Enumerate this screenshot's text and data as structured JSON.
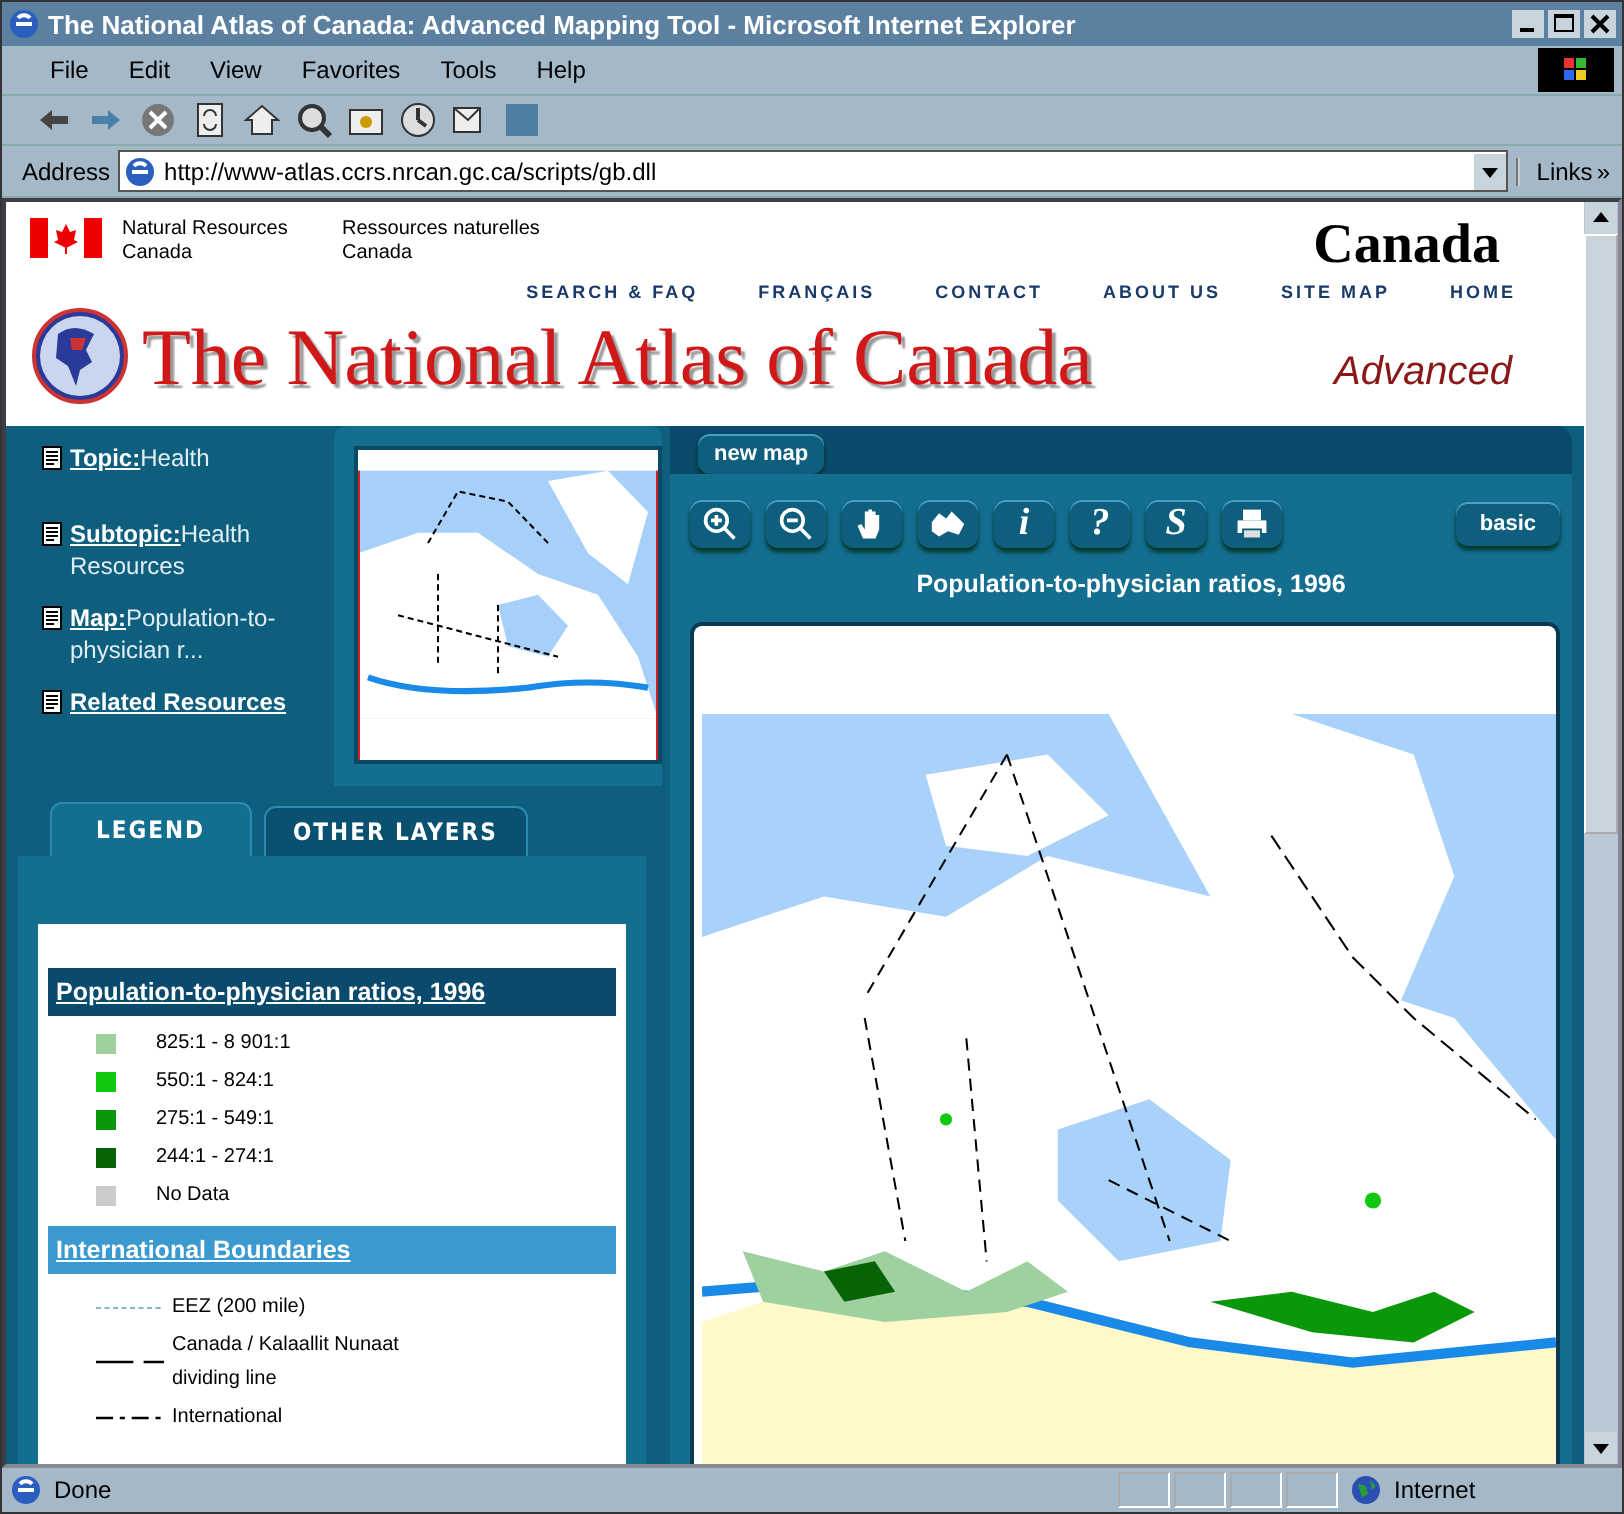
{
  "window": {
    "title": "The National Atlas of Canada: Advanced Mapping Tool - Microsoft Internet Explorer"
  },
  "menu": [
    "File",
    "Edit",
    "View",
    "Favorites",
    "Tools",
    "Help"
  ],
  "address": {
    "label": "Address",
    "value": "http://www-atlas.ccrs.nrcan.gc.ca/scripts/gb.dll",
    "links": "Links",
    "links_more": "»"
  },
  "header": {
    "department_en": "Natural Resources Canada",
    "department_fr": "Ressources naturelles Canada",
    "wordmark": "Canada",
    "nav": [
      "SEARCH & FAQ",
      "FRANÇAIS",
      "CONTACT",
      "ABOUT US",
      "SITE MAP",
      "HOME"
    ],
    "title": "The National Atlas of Canada",
    "mode": "Advanced"
  },
  "topics": [
    {
      "label": "Topic:",
      "value": "Health"
    },
    {
      "label": "Subtopic:",
      "value": "Health Resources"
    },
    {
      "label": "Map:",
      "value": "Population-to-physician r..."
    },
    {
      "label": "Related Resources"
    }
  ],
  "panel_tabs": [
    {
      "label": "LEGEND",
      "selected": true
    },
    {
      "label": "OTHER LAYERS",
      "selected": false
    }
  ],
  "map_tab": "new map",
  "tools": [
    {
      "kind": "zoom-in"
    },
    {
      "kind": "zoom-out"
    },
    {
      "kind": "pan"
    },
    {
      "kind": "region"
    },
    {
      "kind": "glyph",
      "text": "i"
    },
    {
      "kind": "glyph",
      "text": "?"
    },
    {
      "kind": "glyph",
      "text": "S"
    },
    {
      "kind": "print"
    }
  ],
  "basic_button": "basic",
  "map_title": "Population-to-physician ratios, 1996",
  "legend": [
    {
      "title": "Population-to-physician ratios, 1996",
      "kind": "classes",
      "items": [
        {
          "label": "825:1 - 8 901:1",
          "color": "#9fd09f"
        },
        {
          "label": "550:1 - 824:1",
          "color": "#10c810"
        },
        {
          "label": "275:1 - 549:1",
          "color": "#0a980a"
        },
        {
          "label": "244:1 - 274:1",
          "color": "#066406"
        },
        {
          "label": "No Data",
          "color": "#cccccc"
        }
      ]
    },
    {
      "title": "International Boundaries",
      "kind": "lines",
      "items": [
        {
          "label": "EEZ (200 mile)",
          "kind": "dotted"
        },
        {
          "label": "Canada / Kalaallit Nunaat dividing line",
          "kind": "long-dash"
        },
        {
          "label": "International",
          "kind": "dash-dot"
        }
      ]
    }
  ],
  "status": {
    "text": "Done",
    "zone": "Internet"
  }
}
